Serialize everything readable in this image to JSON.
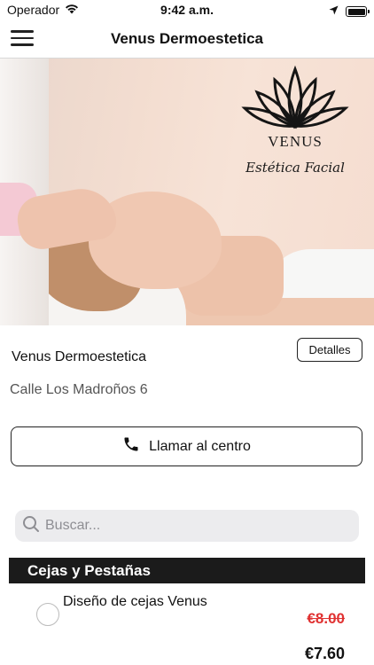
{
  "status_bar": {
    "carrier": "Operador",
    "time": "9:42 a.m."
  },
  "nav": {
    "title": "Venus Dermoestetica"
  },
  "hero": {
    "logo_name": "VENUS",
    "logo_subtitle": "Estética Facial"
  },
  "center": {
    "name": "Venus Dermoestetica",
    "address": "Calle Los Madroños 6",
    "details_label": "Detalles",
    "call_label": "Llamar al centro"
  },
  "search": {
    "placeholder": "Buscar..."
  },
  "category": {
    "title": "Cejas y Pestañas"
  },
  "services": [
    {
      "name": "Diseño de cejas Venus",
      "old_price": "€8.00",
      "price": "€7.60"
    }
  ],
  "colors": {
    "header_bg": "#1b1b1b",
    "discount_red": "#e03232",
    "search_bg": "#ececee"
  }
}
